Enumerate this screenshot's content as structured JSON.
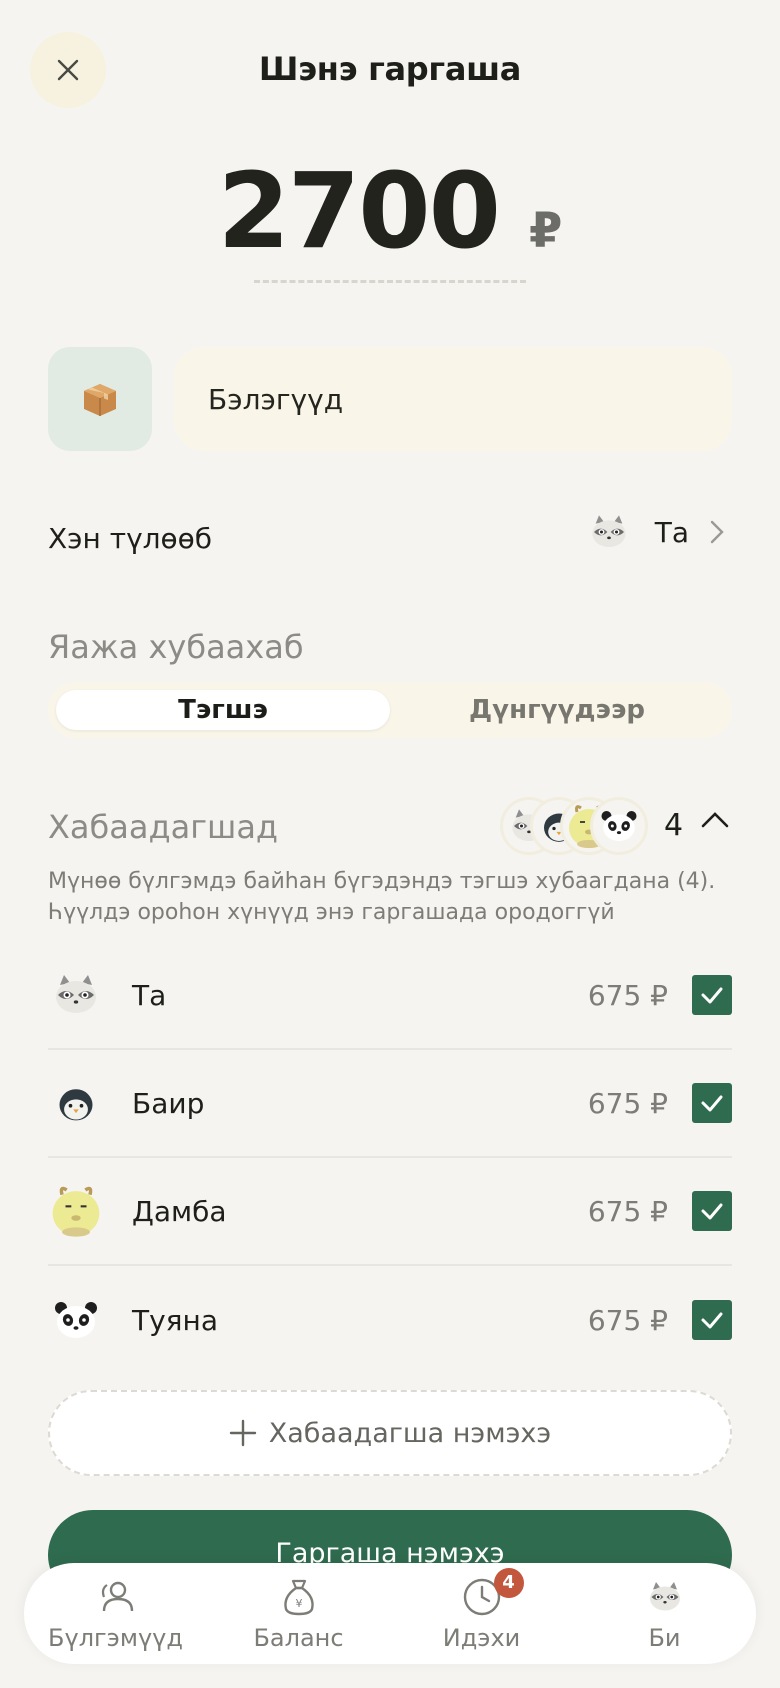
{
  "header": {
    "title": "Шэнэ гаргаша",
    "close_icon": "close-icon"
  },
  "amount": {
    "value": "2700",
    "currency": "₽"
  },
  "category": {
    "icon": "box-icon",
    "name": "Бэлэгүүд"
  },
  "payer": {
    "label": "Хэн түлөөб",
    "value": "Та",
    "avatar": "raccoon-avatar"
  },
  "split": {
    "heading": "Яажа хубаахаб",
    "options": [
      "Тэгшэ",
      "Дүнгүүдээр"
    ],
    "selected": "Тэгшэ"
  },
  "members_section": {
    "heading": "Хабаадагшад",
    "count": "4",
    "note": "Мүнөө бүлгэмдэ байһан бүгэдэндэ тэгшэ хубаагдана (4). Һүүлдэ ороһон хүнүүд энэ гаргашада ородоггүй"
  },
  "members": [
    {
      "name": "Та",
      "amount": "675 ₽",
      "avatar": "raccoon-avatar",
      "checked": true
    },
    {
      "name": "Баир",
      "amount": "675 ₽",
      "avatar": "penguin-avatar",
      "checked": true
    },
    {
      "name": "Дамба",
      "amount": "675 ₽",
      "avatar": "goat-avatar",
      "checked": true
    },
    {
      "name": "Туяна",
      "amount": "675 ₽",
      "avatar": "panda-avatar",
      "checked": true
    }
  ],
  "add_member_label": "Хабаадагша нэмэхэ",
  "primary_button_label": "Гаргаша нэмэхэ",
  "tabbar": {
    "items": [
      {
        "label": "Бүлгэмүүд",
        "icon": "people-icon"
      },
      {
        "label": "Баланс",
        "icon": "money-bag-icon"
      },
      {
        "label": "Идэхи",
        "icon": "clock-icon",
        "badge": "4"
      },
      {
        "label": "Би",
        "icon": "raccoon-avatar"
      }
    ]
  },
  "colors": {
    "accent": "#2f6b4f",
    "background": "#f5f4f0",
    "badge": "#c2573d"
  }
}
